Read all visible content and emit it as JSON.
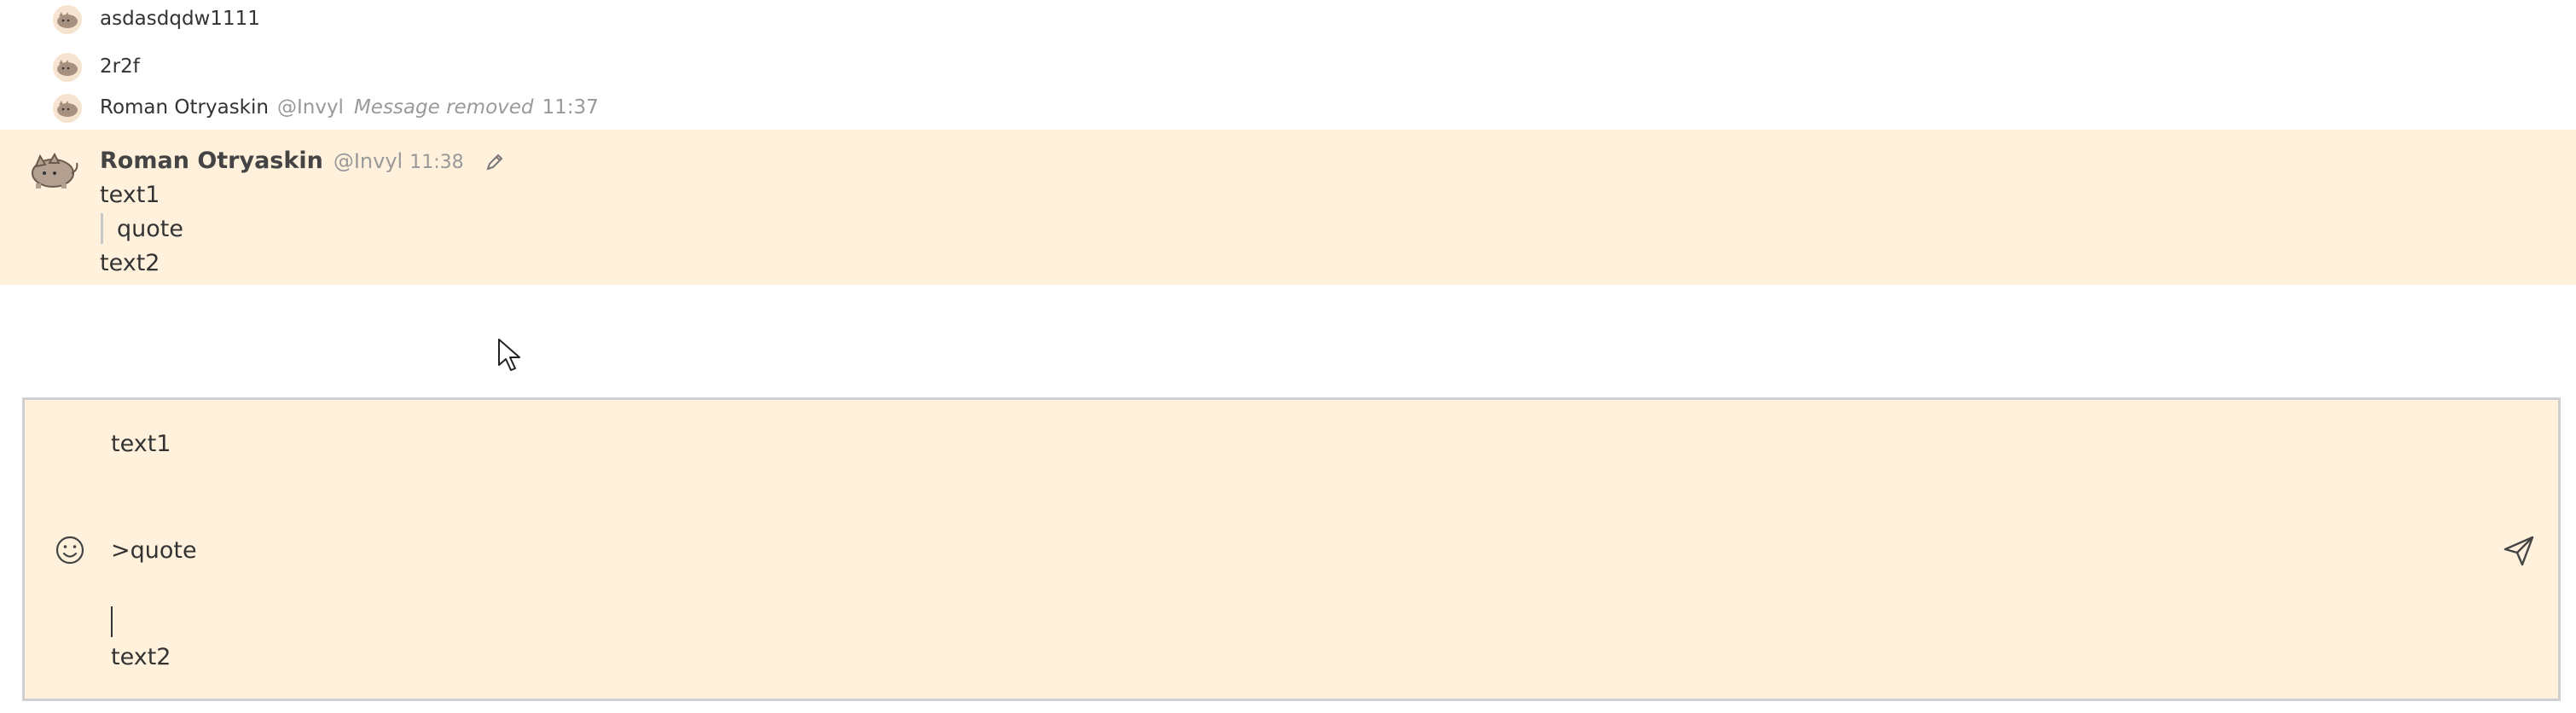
{
  "messages": [
    {
      "text": "asdasdqdw1111"
    },
    {
      "text": "2r2f"
    },
    {
      "author": "Roman Otryaskin",
      "handle": "@Invyl",
      "status": "Message removed",
      "time": "11:37"
    }
  ],
  "highlighted_message": {
    "author": "Roman Otryaskin",
    "handle": "@Invyl",
    "time": "11:38",
    "lines": {
      "line1": "text1",
      "quote": "quote",
      "line3": "text2"
    }
  },
  "composer": {
    "line1": "text1",
    "line2": ">quote",
    "line4": "text2"
  },
  "icons": {
    "avatar": "pusheen-cat-avatar",
    "edit": "pencil-icon",
    "emoji": "smiley-icon",
    "send": "send-icon"
  },
  "colors": {
    "highlight": "#fff1dc",
    "muted": "#999999"
  }
}
